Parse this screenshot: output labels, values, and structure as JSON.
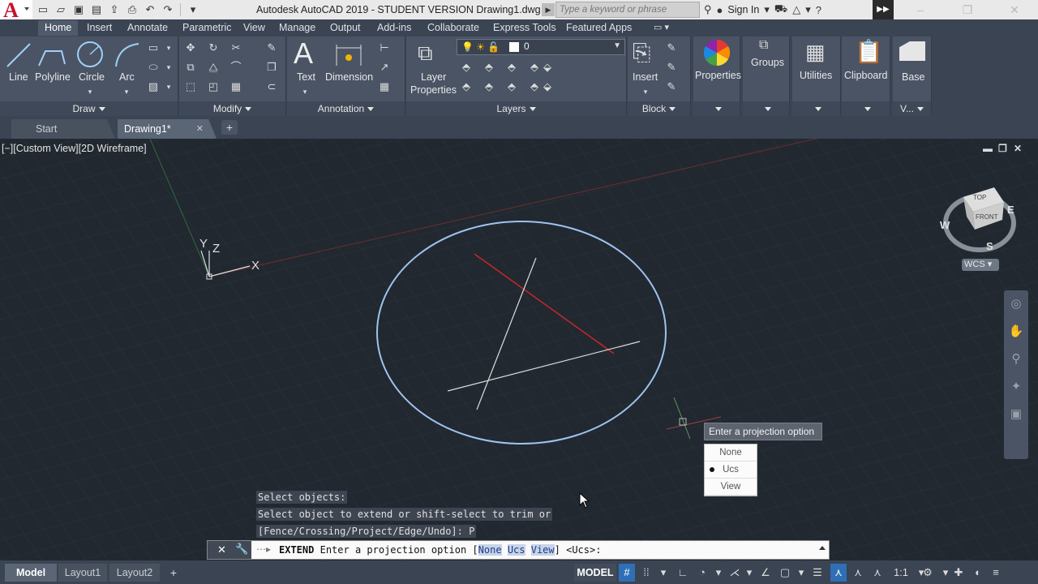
{
  "window": {
    "title": "Autodesk AutoCAD 2019 - STUDENT VERSION    Drawing1.dwg",
    "search_placeholder": "Type a keyword or phrase",
    "sign_in": "Sign In"
  },
  "ribbon_tabs": [
    "Home",
    "Insert",
    "Annotate",
    "Parametric",
    "View",
    "Manage",
    "Output",
    "Add-ins",
    "Collaborate",
    "Express Tools",
    "Featured Apps"
  ],
  "ribbon": {
    "draw": {
      "panel": "Draw",
      "line": "Line",
      "polyline": "Polyline",
      "circle": "Circle",
      "arc": "Arc"
    },
    "modify": {
      "panel": "Modify"
    },
    "annotation": {
      "panel": "Annotation",
      "text": "Text",
      "dimension": "Dimension"
    },
    "layers": {
      "panel": "Layers",
      "layer_properties_1": "Layer",
      "layer_properties_2": "Properties",
      "current_layer": "0"
    },
    "block": {
      "panel": "Block",
      "insert": "Insert"
    },
    "properties": {
      "label": "Properties"
    },
    "groups": {
      "label": "Groups"
    },
    "utilities": {
      "label": "Utilities"
    },
    "clipboard": {
      "label": "Clipboard"
    },
    "base": {
      "label": "Base",
      "panel": "V..."
    }
  },
  "doc_tabs": {
    "start": "Start",
    "drawing": "Drawing1*"
  },
  "viewport": {
    "label": "[−][Custom View][2D Wireframe]",
    "viewcube": {
      "top": "TOP",
      "front": "FRONT",
      "w": "W",
      "e": "E",
      "s": "S",
      "wcs": "WCS"
    },
    "ucs": {
      "x": "X",
      "y": "Y",
      "z": "Z"
    }
  },
  "tooltip": "Enter a projection option",
  "options_menu": {
    "items": [
      "None",
      "Ucs",
      "View"
    ],
    "selected": "Ucs"
  },
  "command_history": [
    "Select objects:",
    "Select object to extend or shift-select to trim or",
    "[Fence/Crossing/Project/Edge/Undo]: P"
  ],
  "command_line": {
    "keyword": "EXTEND",
    "prompt": "Enter a projection option [",
    "opt1": "None",
    "opt2": "Ucs",
    "opt3": "View",
    "suffix": "] <Ucs>:"
  },
  "status": {
    "tabs": [
      "Model",
      "Layout1",
      "Layout2"
    ],
    "model_button": "MODEL",
    "scale": "1:1"
  },
  "colors": {
    "ribbon_bg": "#3b4453",
    "viewport_bg": "#212830",
    "circle": "#9fc3ee",
    "red_line": "#c8262b",
    "accent": "#2f6fb6"
  }
}
